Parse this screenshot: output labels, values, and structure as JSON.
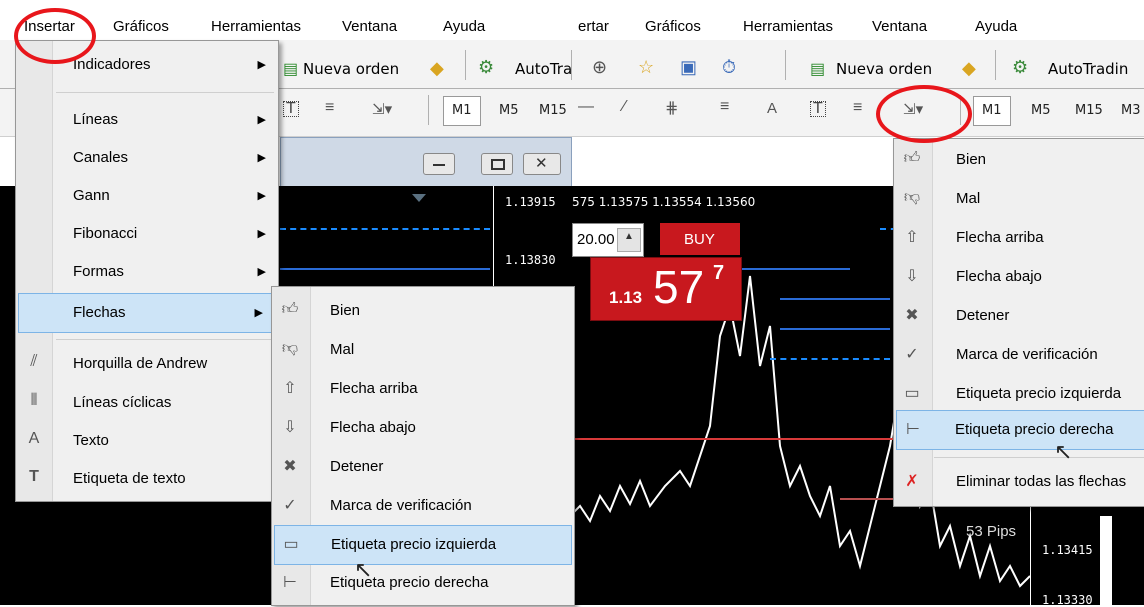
{
  "menubar_left": [
    "Insertar",
    "Gráficos",
    "Herramientas",
    "Ventana",
    "Ayuda"
  ],
  "menubar_right": [
    "ertar",
    "Gráficos",
    "Herramientas",
    "Ventana",
    "Ayuda"
  ],
  "toolbar": {
    "new_order": "Nueva orden",
    "autotrading_left": "AutoTra",
    "autotrading_right": "AutoTradin",
    "timeframes_left": [
      "M1",
      "M5",
      "M15"
    ],
    "timeframes_right": [
      "M1",
      "M5",
      "M15",
      "M3"
    ],
    "text_tool": "A"
  },
  "insert_menu": {
    "items": [
      {
        "label": "Indicadores",
        "icon": "",
        "submenu": true
      },
      {
        "label": "Líneas",
        "icon": "",
        "submenu": true
      },
      {
        "label": "Canales",
        "icon": "",
        "submenu": true
      },
      {
        "label": "Gann",
        "icon": "",
        "submenu": true
      },
      {
        "label": "Fibonacci",
        "icon": "",
        "submenu": true
      },
      {
        "label": "Formas",
        "icon": "",
        "submenu": true
      },
      {
        "label": "Flechas",
        "icon": "",
        "submenu": true,
        "highlighted": true
      },
      {
        "label": "Horquilla de Andrew",
        "icon": "andrews-pitchfork-icon",
        "submenu": false
      },
      {
        "label": "Líneas cíclicas",
        "icon": "cycle-lines-icon",
        "submenu": false
      },
      {
        "label": "Texto",
        "icon": "text-icon",
        "submenu": false
      },
      {
        "label": "Etiqueta de texto",
        "icon": "text-label-icon",
        "submenu": false
      }
    ]
  },
  "arrows_submenu": {
    "items": [
      {
        "label": "Bien",
        "icon": "thumbs-up-icon"
      },
      {
        "label": "Mal",
        "icon": "thumbs-down-icon"
      },
      {
        "label": "Flecha arriba",
        "icon": "arrow-up-icon"
      },
      {
        "label": "Flecha abajo",
        "icon": "arrow-down-icon"
      },
      {
        "label": "Detener",
        "icon": "stop-icon"
      },
      {
        "label": "Marca de verificación",
        "icon": "checkmark-icon"
      },
      {
        "label": "Etiqueta precio izquierda",
        "icon": "left-price-label-icon",
        "highlighted": true
      },
      {
        "label": "Etiqueta precio derecha",
        "icon": "right-price-label-icon"
      }
    ]
  },
  "arrows_dropdown": {
    "items": [
      {
        "label": "Bien",
        "icon": "thumbs-up-icon"
      },
      {
        "label": "Mal",
        "icon": "thumbs-down-icon"
      },
      {
        "label": "Flecha arriba",
        "icon": "arrow-up-icon"
      },
      {
        "label": "Flecha abajo",
        "icon": "arrow-down-icon"
      },
      {
        "label": "Detener",
        "icon": "stop-icon"
      },
      {
        "label": "Marca de verificación",
        "icon": "checkmark-icon"
      },
      {
        "label": "Etiqueta precio izquierda",
        "icon": "left-price-label-icon"
      },
      {
        "label": "Etiqueta precio derecha",
        "icon": "right-price-label-icon",
        "highlighted": true
      },
      {
        "label": "Eliminar todas las flechas",
        "icon": "delete-arrows-icon"
      }
    ]
  },
  "chart": {
    "price_ticks": [
      "1.13915",
      "1.13830",
      "1.13415",
      "1.13330"
    ],
    "quote_line": "575 1.13575 1.13554 1.13560",
    "lot": "20.00",
    "buy_label": "BUY",
    "buy_price_small": "1.13",
    "buy_price_big": "57",
    "buy_price_sup": "7",
    "pips": "53 Pips"
  },
  "colors": {
    "highlight": "#cde4f7",
    "buy": "#c8181e",
    "annotation": "#e8161b",
    "line": "#1a8cff"
  }
}
